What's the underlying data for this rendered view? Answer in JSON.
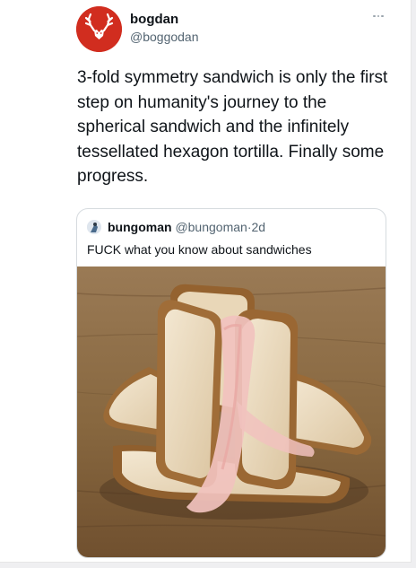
{
  "tweet": {
    "author": {
      "display_name": "bogdan",
      "handle": "@boggodan",
      "avatar_icon": "deer-antlers-icon",
      "avatar_color": "#d12d1f"
    },
    "more_icon": "more-options-icon",
    "text": "3-fold symmetry sandwich is only the first step on humanity's journey to the spherical sandwich and the infinitely tessellated hexagon tortilla. Finally some progress."
  },
  "quote": {
    "author": {
      "display_name": "bungoman",
      "handle": "@bungoman",
      "separator": "·",
      "time": "2d",
      "avatar_icon": "user-avatar-icon"
    },
    "text": "FUCK what you know about sandwiches",
    "image_subject": "three-slice-bread-sandwich-image"
  },
  "colors": {
    "text_primary": "#0f1419",
    "text_secondary": "#536471",
    "border": "#d6dbdf",
    "wood": "#8a6a47",
    "bread_crust": "#9d6a33",
    "bread_crumb": "#ecddc3",
    "ham": "#f1c2be"
  }
}
